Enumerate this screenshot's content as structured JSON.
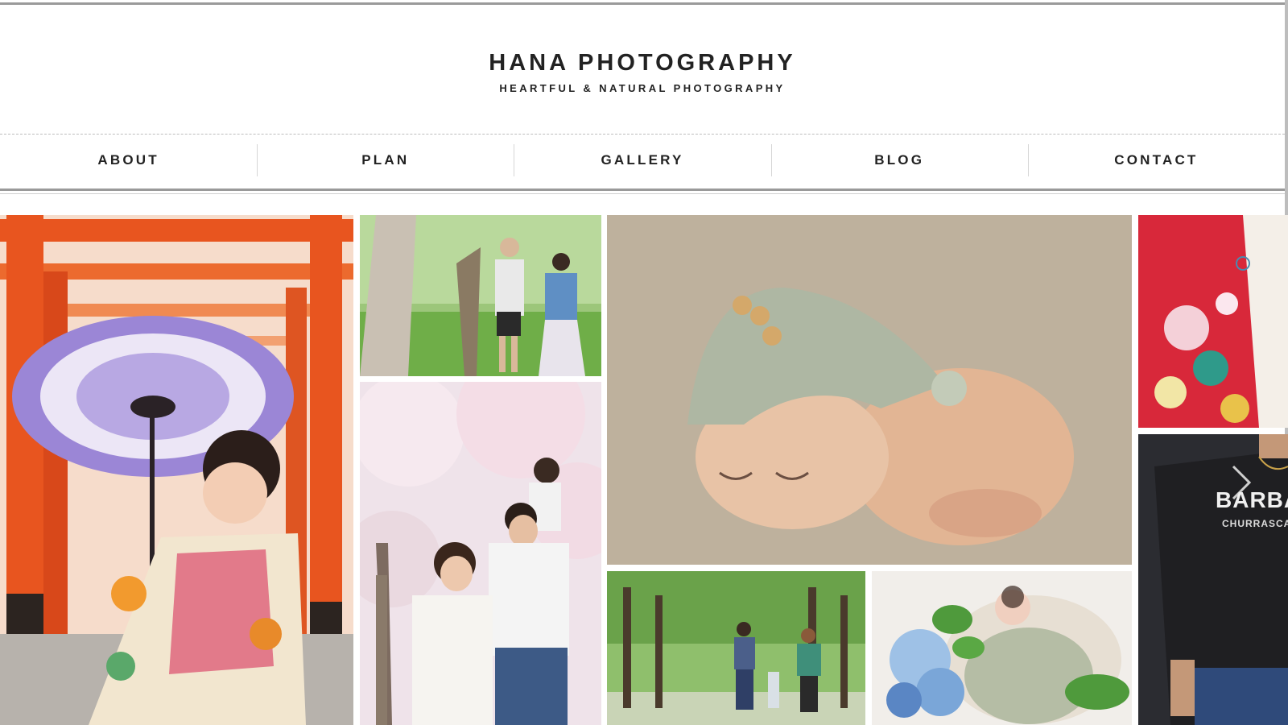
{
  "site": {
    "title": "HANA PHOTOGRAPHY",
    "tagline": "HEARTFUL & NATURAL PHOTOGRAPHY"
  },
  "nav": {
    "items": [
      {
        "label": "ABOUT"
      },
      {
        "label": "PLAN"
      },
      {
        "label": "GALLERY"
      },
      {
        "label": "BLOG"
      },
      {
        "label": "CONTACT"
      }
    ]
  },
  "gallery": {
    "photos": [
      {
        "subject": "girl-kimono-umbrella-torii"
      },
      {
        "subject": "couple-park-maternity"
      },
      {
        "subject": "family-cherry-blossoms"
      },
      {
        "subject": "newborn-knit-hat"
      },
      {
        "subject": "family-tree-path"
      },
      {
        "subject": "newborn-hydrangea-basket"
      },
      {
        "subject": "red-kimono-detail"
      },
      {
        "subject": "man-black-tshirt",
        "shirt_text": "BARBAC",
        "shirt_subtext": "CHURRASCA"
      }
    ]
  },
  "colors": {
    "torii_orange": "#e8551f",
    "umbrella_purple": "#9b86d6",
    "blanket_beige": "#b9ab97",
    "foliage_green": "#5f9e3e",
    "kimono_red": "#d8283a",
    "shirt_black": "#1f1f22"
  }
}
